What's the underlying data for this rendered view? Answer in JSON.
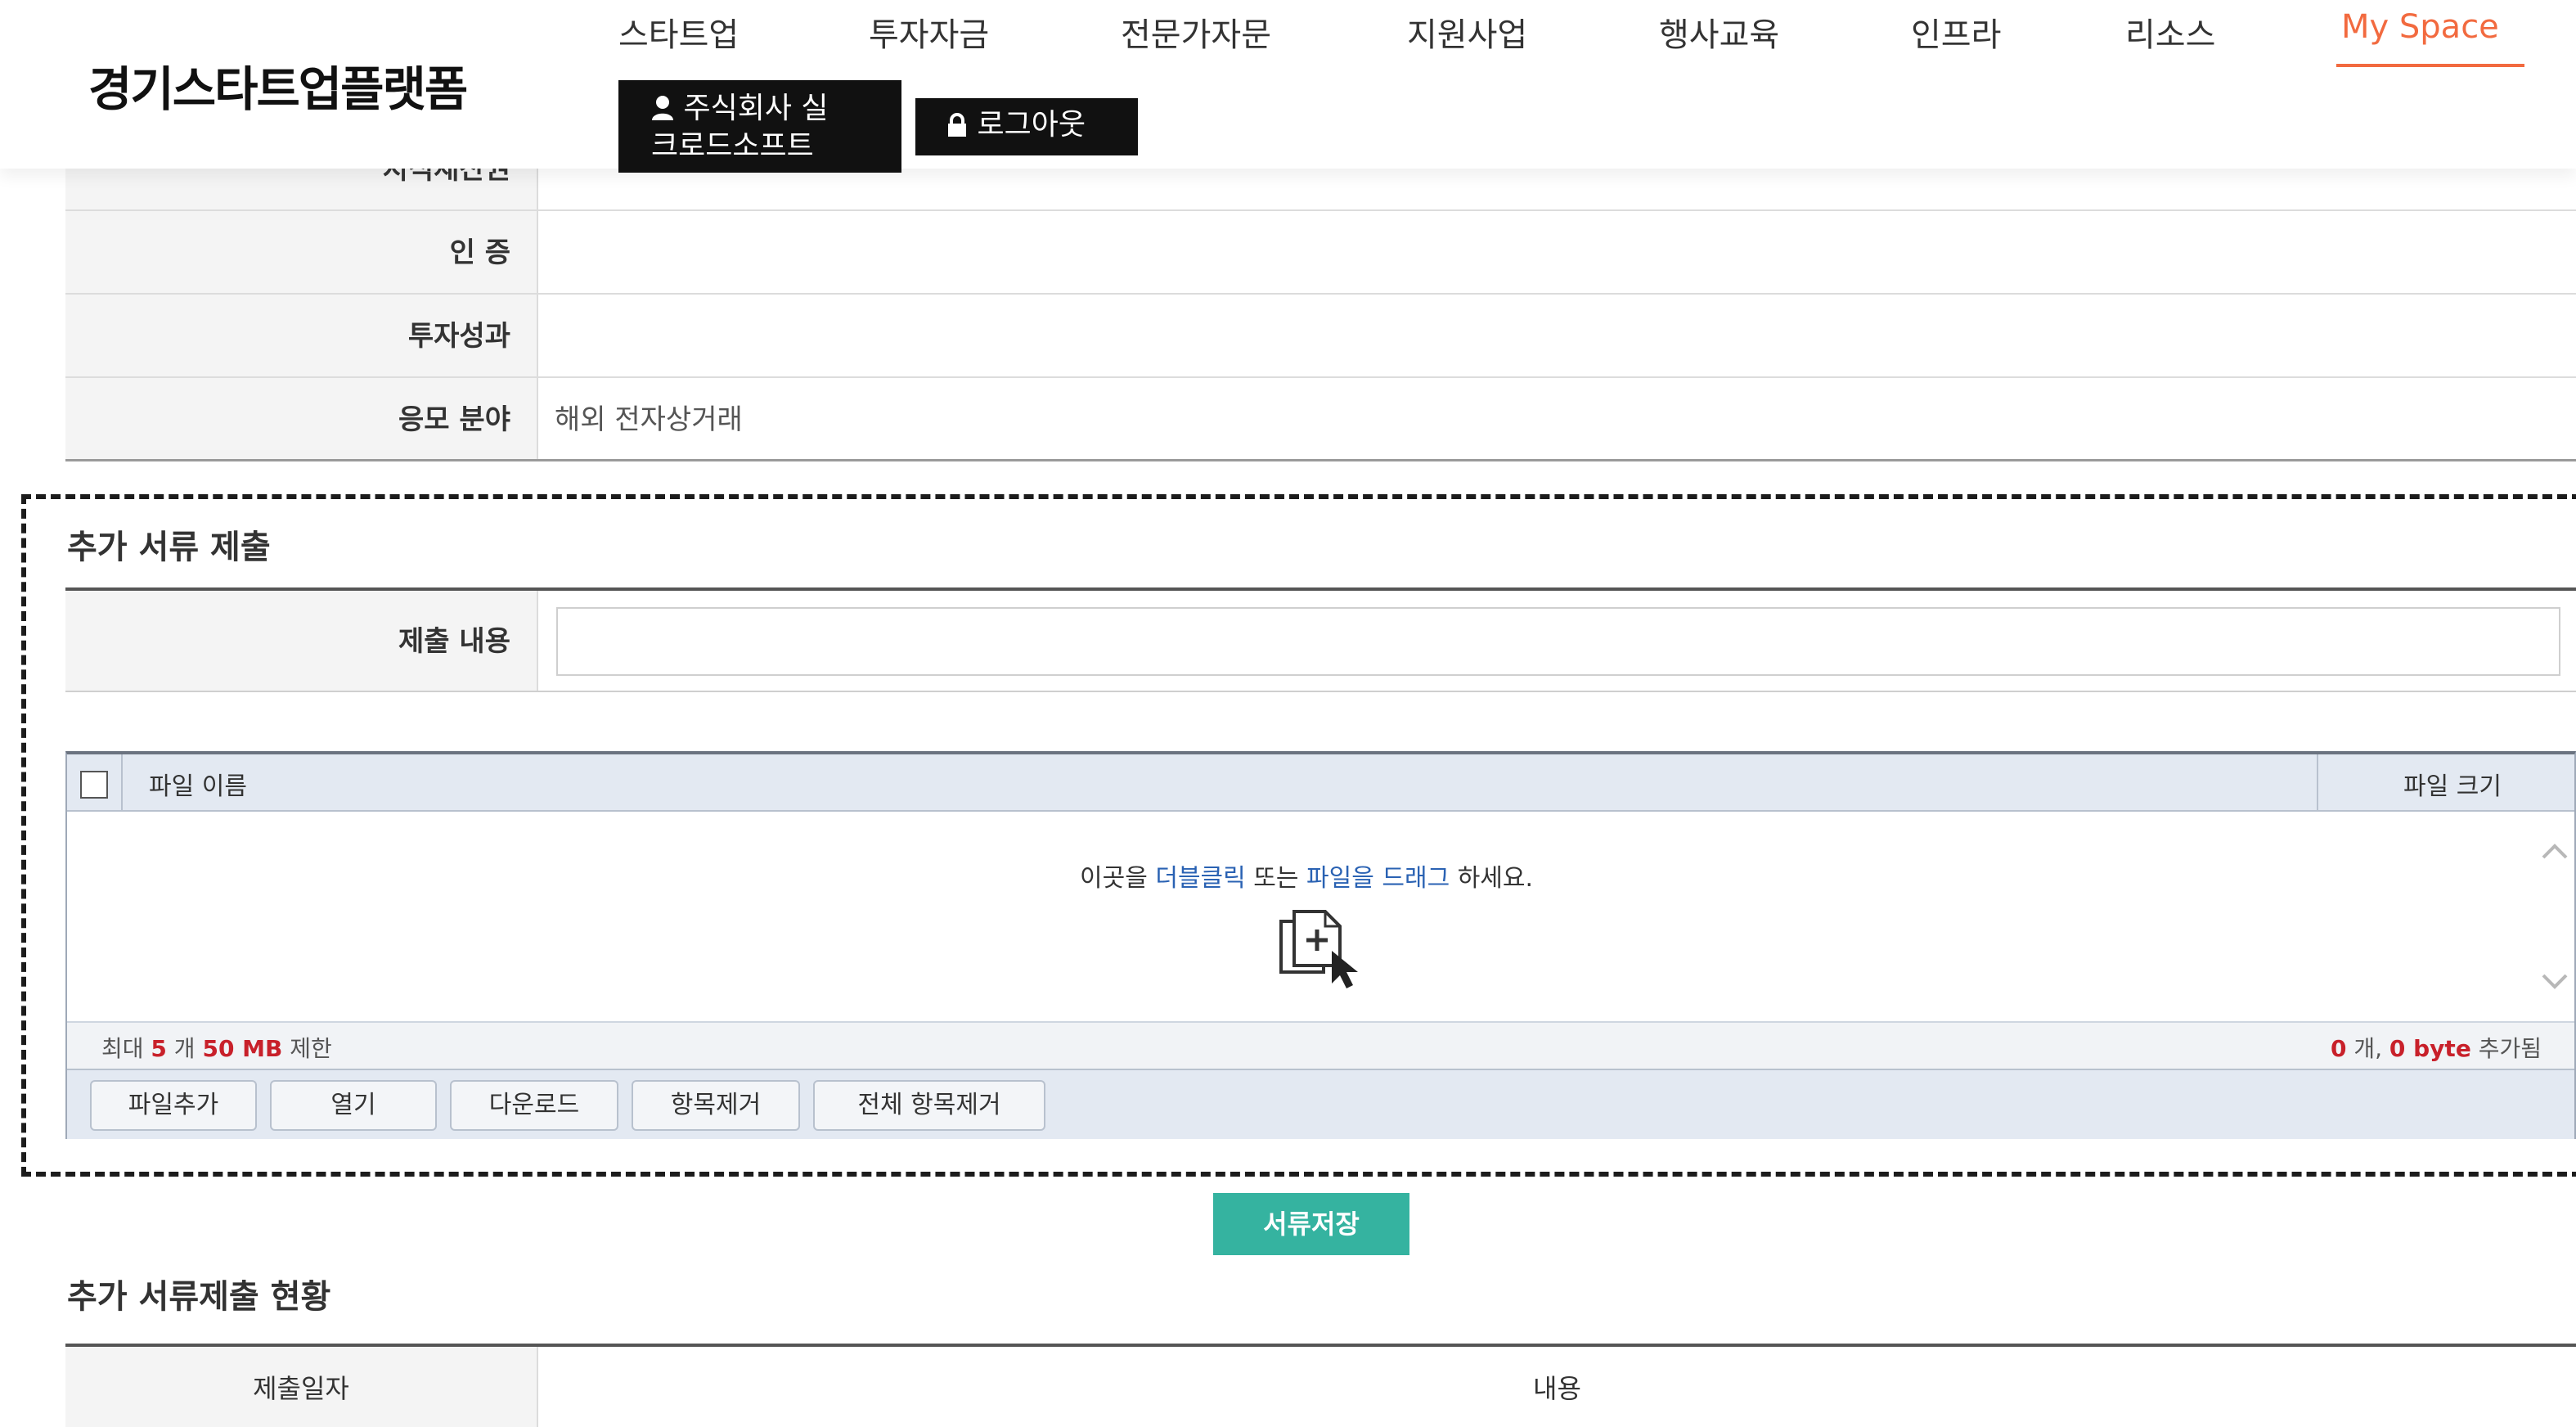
{
  "header": {
    "logo": "경기스타트업플랫폼",
    "nav": [
      "스타트업",
      "투자자금",
      "전문가자문",
      "지원사업",
      "행사교육",
      "인프라",
      "리소스",
      "My Space"
    ],
    "active_nav": "My Space",
    "user_line1": "주식회사 실",
    "user_line2": "크로드소프트",
    "logout_label": "로그아웃",
    "accent_color": "#f26a3f"
  },
  "info_rows": [
    {
      "label": "지식재산권",
      "value": ""
    },
    {
      "label": "인 증",
      "value": ""
    },
    {
      "label": "투자성과",
      "value": ""
    },
    {
      "label": "응모 분야",
      "value": "해외 전자상거래"
    }
  ],
  "additional_docs": {
    "title": "추가 서류 제출",
    "submit_label": "제출 내용",
    "submit_value": "",
    "uploader": {
      "col_name": "파일 이름",
      "col_size": "파일 크기",
      "drop_prefix": "이곳을 ",
      "drop_link1": "더블클릭",
      "drop_mid": " 또는 ",
      "drop_link2": "파일을 드래그",
      "drop_suffix": " 하세요.",
      "limit_prefix": "최대 ",
      "limit_count": "5",
      "limit_count_unit": " 개 ",
      "limit_size": "50 MB",
      "limit_suffix": " 제한",
      "added_count": "0",
      "added_count_unit": " 개, ",
      "added_size": "0 byte",
      "added_suffix": " 추가됨",
      "buttons": [
        "파일추가",
        "열기",
        "다운로드",
        "항목제거",
        "전체 항목제거"
      ]
    }
  },
  "save_button": "서류저장",
  "status": {
    "title": "추가 서류제출 현황",
    "col_date": "제출일자",
    "col_content": "내용"
  },
  "icons": {
    "user": "user-icon",
    "lock": "lock-icon",
    "add_file": "add-file-icon",
    "scroll_up": "chevron-up-icon",
    "scroll_down": "chevron-down-icon"
  },
  "colors": {
    "save": "#35b3a0",
    "link": "#2a62b3",
    "limit_red": "#c8202a"
  }
}
